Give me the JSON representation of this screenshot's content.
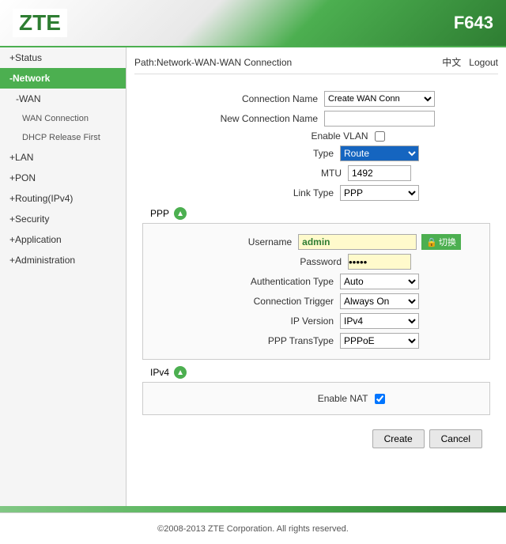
{
  "header": {
    "logo": "ZTE",
    "model": "F643"
  },
  "breadcrumb": {
    "text": "Path:Network-WAN-WAN Connection",
    "lang_link": "中文",
    "logout_link": "Logout"
  },
  "sidebar": {
    "items": [
      {
        "id": "status",
        "label": "Status",
        "level": 0,
        "prefix": "+",
        "active": false
      },
      {
        "id": "network",
        "label": "Network",
        "level": 0,
        "prefix": "-",
        "active": true
      },
      {
        "id": "wan",
        "label": "WAN",
        "level": 1,
        "prefix": "-",
        "active": false
      },
      {
        "id": "wan-connection",
        "label": "WAN Connection",
        "level": 2,
        "active": false
      },
      {
        "id": "dhcp-release",
        "label": "DHCP Release First",
        "level": 2,
        "active": false
      },
      {
        "id": "lan",
        "label": "LAN",
        "level": 0,
        "prefix": "+",
        "active": false
      },
      {
        "id": "pon",
        "label": "PON",
        "level": 0,
        "prefix": "+",
        "active": false
      },
      {
        "id": "routing",
        "label": "Routing(IPv4)",
        "level": 0,
        "prefix": "+",
        "active": false
      },
      {
        "id": "security",
        "label": "Security",
        "level": 0,
        "prefix": "+",
        "active": false
      },
      {
        "id": "application",
        "label": "Application",
        "level": 0,
        "prefix": "+",
        "active": false
      },
      {
        "id": "administration",
        "label": "Administration",
        "level": 0,
        "prefix": "+",
        "active": false
      }
    ]
  },
  "form": {
    "connection_name_label": "Connection Name",
    "connection_name_placeholder": "Create WAN Conn▼",
    "new_connection_label": "New Connection Name",
    "enable_vlan_label": "Enable VLAN",
    "type_label": "Type",
    "type_value": "Route",
    "mtu_label": "MTU",
    "mtu_value": "1492",
    "link_type_label": "Link Type",
    "link_type_value": "PPP",
    "ppp_section": "PPP",
    "username_label": "Username",
    "username_value": "admin",
    "switch_btn_label": "🔒切换",
    "password_label": "Password",
    "auth_type_label": "Authentication Type",
    "auth_type_value": "Auto",
    "conn_trigger_label": "Connection Trigger",
    "conn_trigger_value": "Always On",
    "ip_version_label": "IP Version",
    "ip_version_value": "IPv4",
    "ppp_transtype_label": "PPP TransType",
    "ppp_transtype_value": "PPPoE",
    "ipv4_section": "IPv4",
    "enable_nat_label": "Enable NAT"
  },
  "actions": {
    "create_label": "Create",
    "cancel_label": "Cancel"
  },
  "footer": {
    "copyright": "©2008-2013 ZTE Corporation. All rights reserved."
  }
}
